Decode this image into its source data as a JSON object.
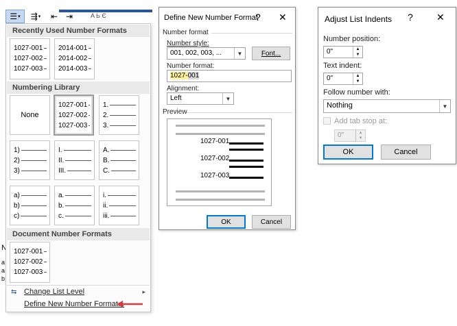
{
  "ribbon": {
    "list_glyph": "☰",
    "multilevel_glyph": "⇶",
    "indent_glyph": "⇤",
    "outdent_glyph": "⇥",
    "doc_fragment": "A Ь Є",
    "accent": "#2b579a"
  },
  "gallery": {
    "recent_header": "Recently Used Number Formats",
    "library_header": "Numbering Library",
    "document_header": "Document Number Formats",
    "none_label": "None",
    "recent": [
      [
        "1027-001",
        "1027-002",
        "1027-003"
      ],
      [
        "2014-001",
        "2014-002",
        "2014-003"
      ]
    ],
    "library": [
      [
        "1027-001",
        "1027-002",
        "1027-003"
      ],
      [
        "1.",
        "2.",
        "3."
      ],
      [
        "1)",
        "2)",
        "3)"
      ],
      [
        "I.",
        "II.",
        "III."
      ],
      [
        "A.",
        "B.",
        "C."
      ],
      [
        "a)",
        "b)",
        "c)"
      ],
      [
        "a.",
        "b.",
        "c."
      ],
      [
        "i.",
        "ii.",
        "iii."
      ]
    ],
    "document": [
      [
        "1027-001",
        "1027-002",
        "1027-003"
      ]
    ],
    "change_list_level": "Change List Level",
    "define_new": "Define New Number Format...",
    "submenu_arrow": "▸",
    "arrow_color": "#d83b3b"
  },
  "left_doc_margin": [
    "N",
    "a",
    "a",
    "b"
  ],
  "define_dialog": {
    "title": "Define New Number Format",
    "help": "?",
    "close": "✕",
    "group_label": "Number format",
    "style_label": "Number style:",
    "style_value": "001, 002, 003, ...",
    "font_button": "Font...",
    "format_label": "Number format:",
    "format_prefix": "1027-",
    "format_suffix": "001",
    "alignment_label": "Alignment:",
    "alignment_value": "Left",
    "preview_label": "Preview",
    "preview_items": [
      "1027-001",
      "1027-002",
      "1027-003"
    ],
    "ok": "OK",
    "cancel": "Cancel"
  },
  "indent_dialog": {
    "title": "Adjust List Indents",
    "help": "?",
    "close": "✕",
    "number_position_label": "Number position:",
    "number_position_value": "0\"",
    "text_indent_label": "Text indent:",
    "text_indent_value": "0\"",
    "follow_label": "Follow number with:",
    "follow_value": "Nothing",
    "tab_stop_label": "Add tab stop at:",
    "tab_stop_value": "0\"",
    "ok": "OK",
    "cancel": "Cancel"
  }
}
